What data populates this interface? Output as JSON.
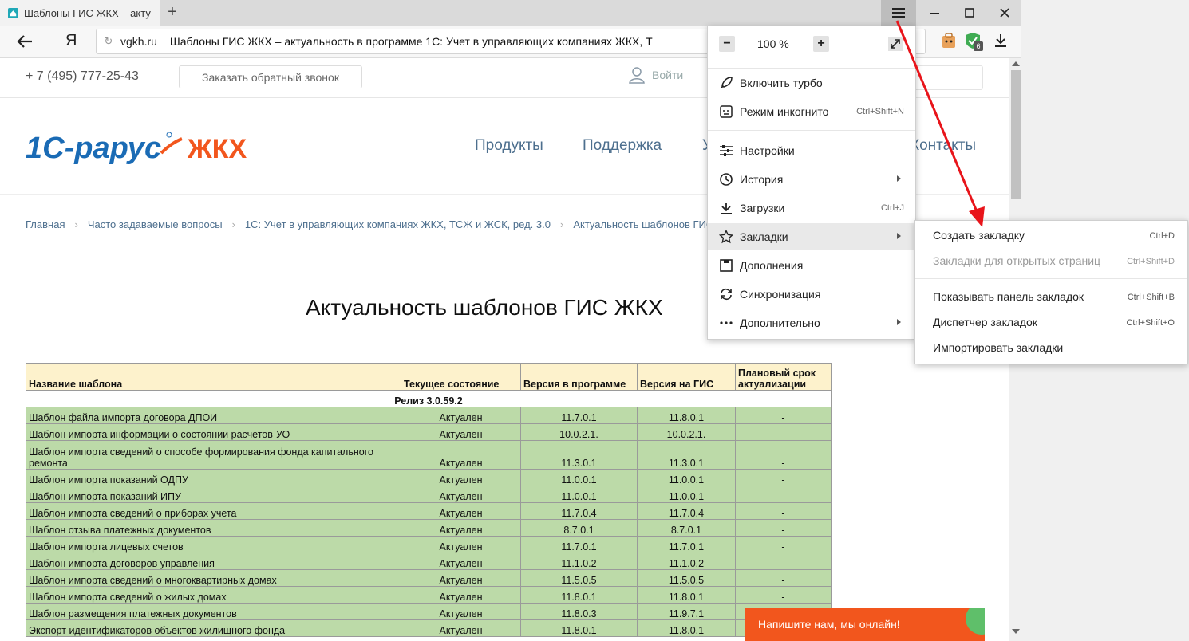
{
  "tab": {
    "title": "Шаблоны ГИС ЖКХ – акту",
    "new_tab": "+"
  },
  "address": {
    "logo": "Я",
    "domain": "vgkh.ru",
    "page_title": "Шаблоны ГИС ЖКХ – актуальность в программе 1С: Учет в управляющих компаниях ЖКХ, Т",
    "badge_count": "6"
  },
  "site": {
    "phone": "+ 7 (495) 777-25-43",
    "callback": "Заказать обратный звонок",
    "login": "Войти",
    "logo_left": "1С-рарус",
    "logo_right": "ЖКХ",
    "nav": [
      "Продукты",
      "Поддержка",
      "У",
      "Контакты"
    ],
    "breadcrumbs": [
      "Главная",
      "Часто задаваемые вопросы",
      "1С: Учет в управляющих компаниях ЖКХ, ТСЖ и ЖСК, ред. 3.0",
      "Актуальность шаблонов ГИС ЖК"
    ],
    "heading": "Актуальность шаблонов ГИС ЖКХ",
    "chat": "Напишите нам, мы онлайн!"
  },
  "table": {
    "headers": [
      "Название шаблона",
      "Текущее состояние",
      "Версия в программе",
      "Версия на ГИС",
      "Плановый срок актуализации"
    ],
    "release": "Релиз 3.0.59.2",
    "rows": [
      [
        "Шаблон файла импорта договора ДПОИ",
        "Актуален",
        "11.7.0.1",
        "11.8.0.1",
        "-"
      ],
      [
        "Шаблон импорта информации о состоянии расчетов-УО",
        "Актуален",
        "10.0.2.1.",
        "10.0.2.1.",
        "-"
      ],
      [
        "Шаблон импорта сведений о способе формирования фонда капитального ремонта",
        "Актуален",
        "11.3.0.1",
        "11.3.0.1",
        "-"
      ],
      [
        "Шаблон импорта показаний ОДПУ",
        "Актуален",
        "11.0.0.1",
        "11.0.0.1",
        "-"
      ],
      [
        "Шаблон импорта показаний ИПУ",
        "Актуален",
        "11.0.0.1",
        "11.0.0.1",
        "-"
      ],
      [
        "Шаблон импорта сведений о приборах учета",
        "Актуален",
        "11.7.0.4",
        "11.7.0.4",
        "-"
      ],
      [
        "Шаблон отзыва платежных документов",
        "Актуален",
        "8.7.0.1",
        "8.7.0.1",
        "-"
      ],
      [
        "Шаблон импорта лицевых счетов",
        "Актуален",
        "11.7.0.1",
        "11.7.0.1",
        "-"
      ],
      [
        "Шаблон импорта договоров управления",
        "Актуален",
        "11.1.0.2",
        "11.1.0.2",
        "-"
      ],
      [
        "Шаблон импорта сведений о многоквартирных домах",
        "Актуален",
        "11.5.0.5",
        "11.5.0.5",
        "-"
      ],
      [
        "Шаблон импорта сведений о жилых домах",
        "Актуален",
        "11.8.0.1",
        "11.8.0.1",
        "-"
      ],
      [
        "Шаблон размещения платежных документов",
        "Актуален",
        "11.8.0.3",
        "11.9.7.1",
        ""
      ],
      [
        "Экспорт идентификаторов объектов жилищного фонда",
        "Актуален",
        "11.8.0.1",
        "11.8.0.1",
        ""
      ]
    ]
  },
  "menu": {
    "zoom_minus": "−",
    "zoom": "100 %",
    "zoom_plus": "+",
    "items": [
      {
        "label": "Включить турбо",
        "shortcut": ""
      },
      {
        "label": "Режим инкогнито",
        "shortcut": "Ctrl+Shift+N"
      },
      {
        "label": "Настройки",
        "shortcut": ""
      },
      {
        "label": "История",
        "shortcut": ""
      },
      {
        "label": "Загрузки",
        "shortcut": "Ctrl+J"
      },
      {
        "label": "Закладки",
        "shortcut": ""
      },
      {
        "label": "Дополнения",
        "shortcut": ""
      },
      {
        "label": "Синхронизация",
        "shortcut": ""
      },
      {
        "label": "Дополнительно",
        "shortcut": ""
      }
    ]
  },
  "submenu": {
    "items": [
      {
        "label": "Создать закладку",
        "shortcut": "Ctrl+D"
      },
      {
        "label": "Закладки для открытых страниц",
        "shortcut": "Ctrl+Shift+D"
      },
      {
        "label": "Показывать панель закладок",
        "shortcut": "Ctrl+Shift+B"
      },
      {
        "label": "Диспетчер закладок",
        "shortcut": "Ctrl+Shift+O"
      },
      {
        "label": "Импортировать закладки",
        "shortcut": ""
      }
    ]
  },
  "colors": {
    "accent_orange": "#f2561d",
    "logo_blue": "#1a6bb5",
    "annotation_red": "#e8141a",
    "table_green": "#bcdaa8",
    "table_header": "#fdf2cc"
  }
}
